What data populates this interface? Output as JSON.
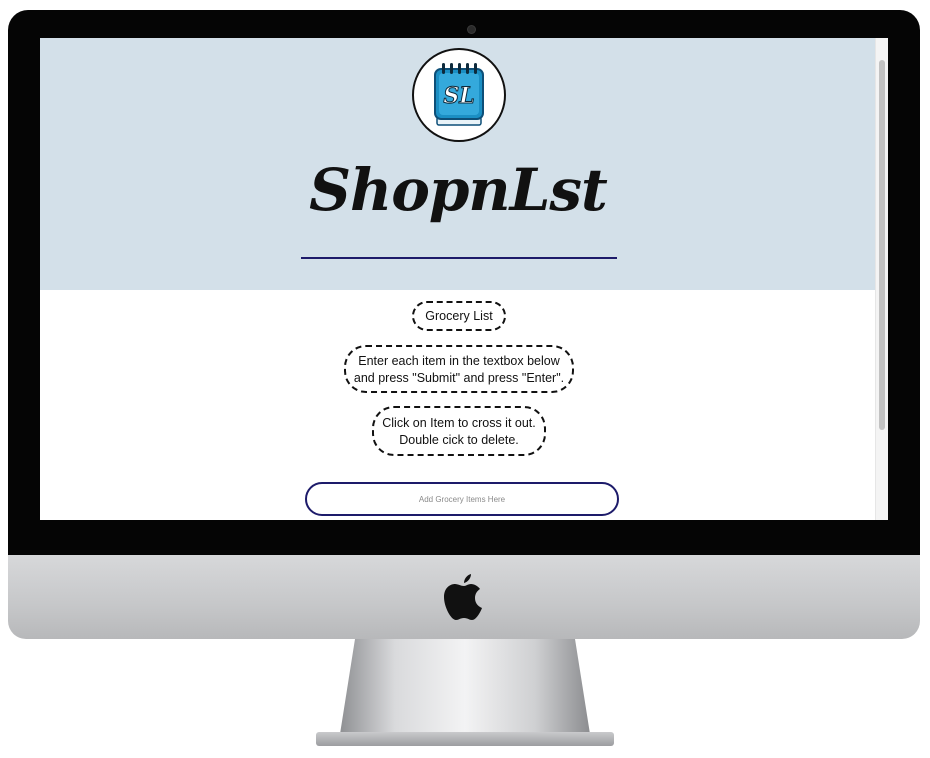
{
  "device": {
    "camera_icon": "webcam-dot",
    "brand_icon": "apple-logo-icon"
  },
  "app": {
    "logo": {
      "icon": "notepad-icon",
      "initials": "SL",
      "colors": {
        "body": "#1b8fc4",
        "dark": "#0d4f78",
        "pages": "#e9f3f8"
      }
    },
    "title": "ShopnLst",
    "colors": {
      "hero_background": "#d3e0e9",
      "accent_rule": "#1d1b6a",
      "input_border": "#1d1b6a"
    }
  },
  "content": {
    "list_heading": "Grocery List",
    "instructions_1": {
      "line1": "Enter each item in the textbox below",
      "line2": "and press \"Submit\" and press \"Enter\"."
    },
    "instructions_2": {
      "line1": "Click on Item to cross it out.",
      "line2": "Double cick to delete."
    },
    "input": {
      "placeholder": "Add Grocery Items Here",
      "value": ""
    }
  }
}
